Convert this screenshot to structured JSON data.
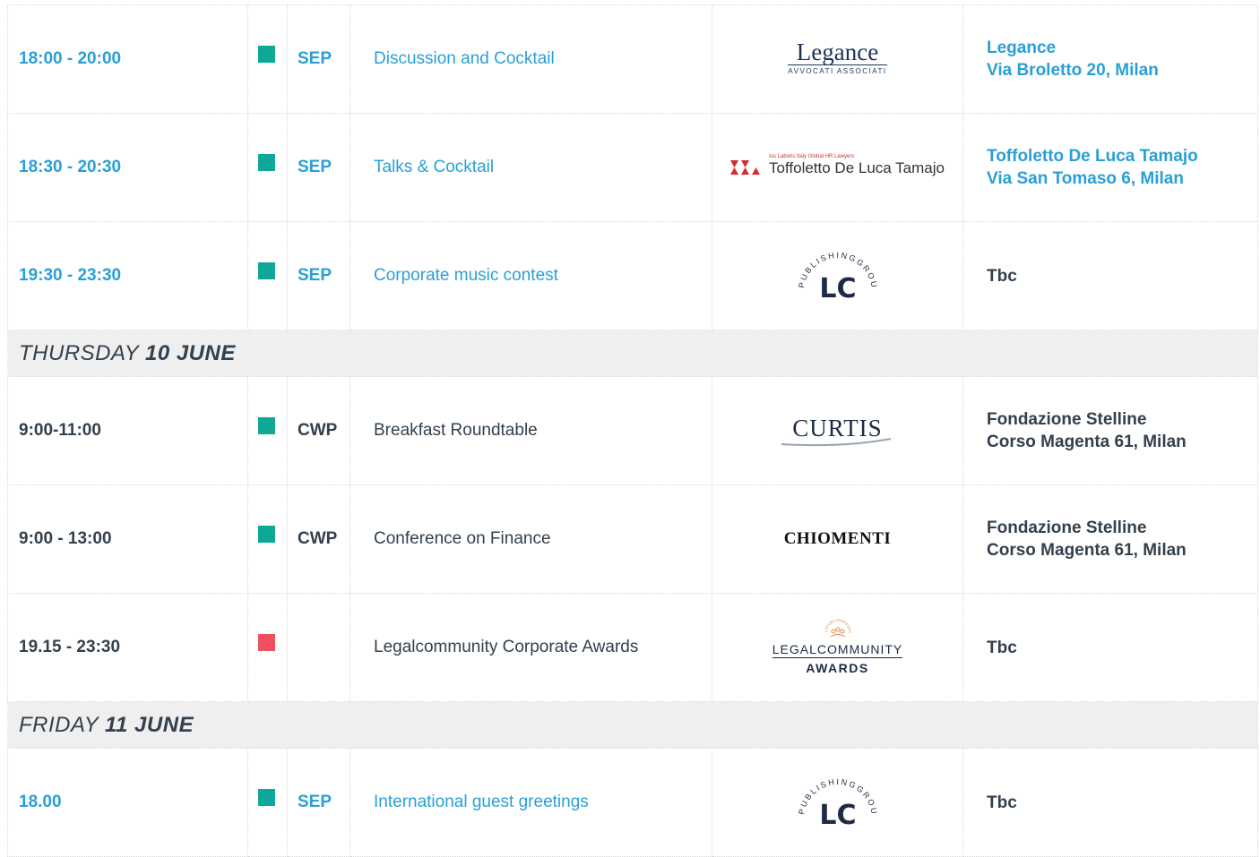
{
  "colors": {
    "accent_blue": "#2a9fd6",
    "dark_text": "#33404d",
    "square_green": "#0fa898",
    "square_red": "#f0505e",
    "day_band": "#efefef"
  },
  "events_top": [
    {
      "time": "18:00 - 20:00",
      "code": "SEP",
      "title": "Discussion and Cocktail",
      "logo": "legance-logo",
      "loc1": "Legance",
      "loc2": "Via Broletto 20, Milan"
    },
    {
      "time": "18:30 - 20:30",
      "code": "SEP",
      "title": "Talks & Cocktail",
      "logo": "toffoletto-logo",
      "loc1": "Toffoletto De Luca Tamajo",
      "loc2": "Via San Tomaso 6, Milan"
    },
    {
      "time": "19:30 - 23:30",
      "code": "SEP",
      "title": "Corporate music contest",
      "logo": "lc-publishing-group-logo",
      "loc1": "Tbc"
    }
  ],
  "day_thursday": {
    "weekday": "THURSDAY",
    "date": "10 JUNE"
  },
  "events_thursday": [
    {
      "time": "9:00-11:00",
      "code": "CWP",
      "title": "Breakfast Roundtable",
      "logo": "curtis-logo",
      "loc1": "Fondazione Stelline",
      "loc2": "Corso Magenta 61, Milan"
    },
    {
      "time": "9:00 - 13:00",
      "code": "CWP",
      "title": "Conference on Finance",
      "logo": "chiomenti-logo",
      "loc1": "Fondazione Stelline",
      "loc2": "Corso Magenta 61, Milan"
    },
    {
      "time": "19.15 - 23:30",
      "code": "",
      "title": "Legalcommunity Corporate Awards",
      "logo": "legalcommunity-awards-logo",
      "loc1": "Tbc"
    }
  ],
  "day_friday": {
    "weekday": "FRIDAY",
    "date": "11 JUNE"
  },
  "events_friday": [
    {
      "time": "18.00",
      "code": "SEP",
      "title": "International guest greetings",
      "logo": "lc-publishing-group-logo",
      "loc1": "Tbc"
    }
  ],
  "logos": {
    "legance": {
      "name": "Legance",
      "sub": "AVVOCATI ASSOCIATI"
    },
    "toffoletto": {
      "sub1": "Ius Laboris Italy Global HR Lawyers",
      "name": "Toffoletto De Luca Tamajo"
    },
    "lc": {
      "ring": "PUBLISHINGGROUP",
      "mark": "LC"
    },
    "curtis": {
      "name": "CURTIS"
    },
    "chiomenti": {
      "name": "CHIOMENTI"
    },
    "lcawards": {
      "ring": "LCPUBLISHINGGROUP",
      "main": "LEGALCOMMUNITY",
      "sub": "AWARDS"
    }
  }
}
